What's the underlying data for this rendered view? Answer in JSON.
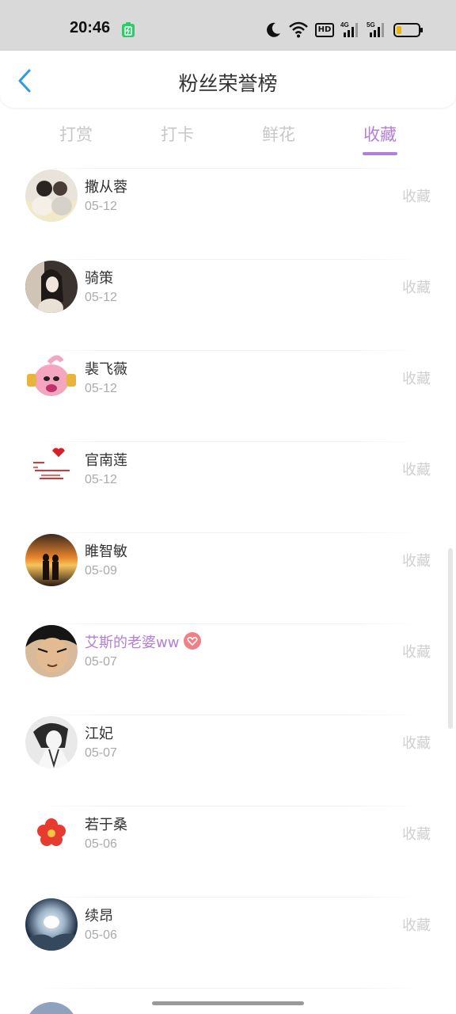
{
  "status_bar": {
    "time": "20:46",
    "hd_label": "HD",
    "signal_labels": [
      "4G",
      "5G"
    ],
    "icons": [
      "battery-saver-icon",
      "moon-icon",
      "wifi-icon",
      "hd-icon",
      "signal-icon",
      "battery-icon"
    ]
  },
  "header": {
    "title": "粉丝荣誉榜",
    "back_icon": "chevron-left-icon"
  },
  "tabs": [
    {
      "label": "打赏",
      "active": false
    },
    {
      "label": "打卡",
      "active": false
    },
    {
      "label": "鲜花",
      "active": false
    },
    {
      "label": "收藏",
      "active": true
    }
  ],
  "colors": {
    "accent": "#b47fd8",
    "back_arrow": "#2f9be0",
    "inactive_tab": "#c7c7c7",
    "date_text": "#aaaaaa"
  },
  "fans": [
    {
      "name": "撒从蓉",
      "date": "05-12",
      "action": "收藏",
      "highlight": false
    },
    {
      "name": "骑策",
      "date": "05-12",
      "action": "收藏",
      "highlight": false
    },
    {
      "name": "裴飞薇",
      "date": "05-12",
      "action": "收藏",
      "highlight": false
    },
    {
      "name": "官南莲",
      "date": "05-12",
      "action": "收藏",
      "highlight": false
    },
    {
      "name": "睢智敏",
      "date": "05-09",
      "action": "收藏",
      "highlight": false
    },
    {
      "name": "艾斯的老婆ww",
      "date": "05-07",
      "action": "收藏",
      "highlight": true,
      "badge": "heart-badge-icon"
    },
    {
      "name": "江妃",
      "date": "05-07",
      "action": "收藏",
      "highlight": false
    },
    {
      "name": "若于桑",
      "date": "05-06",
      "action": "收藏",
      "highlight": false
    },
    {
      "name": "续昂",
      "date": "05-06",
      "action": "收藏",
      "highlight": false
    }
  ]
}
